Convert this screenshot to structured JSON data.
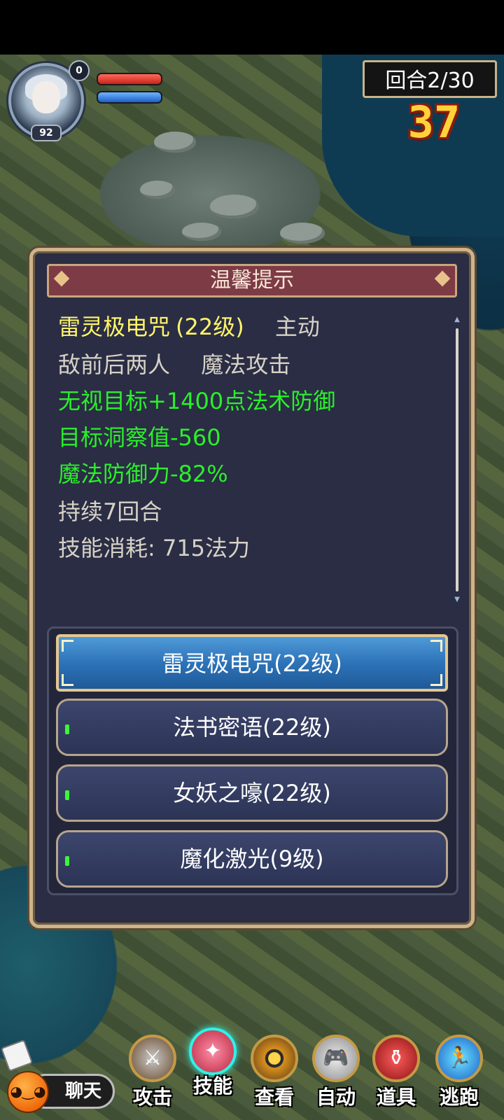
{
  "hud": {
    "player_level": "92",
    "badge_count": "0",
    "round_label": "回合2/30",
    "countdown": "37"
  },
  "dialog": {
    "title": "温馨提示",
    "skill_name": "雷灵极电咒",
    "skill_level": "(22级)",
    "skill_type": "主动",
    "targets": "敌前后两人",
    "attack_type": "魔法攻击",
    "effects": [
      "无视目标+1400点法术防御",
      "目标洞察值-560",
      "魔法防御力-82%"
    ],
    "duration": "持续7回合",
    "cost": "技能消耗: 715法力"
  },
  "skills": [
    {
      "label": "雷灵极电咒(22级)",
      "selected": true
    },
    {
      "label": "法书密语(22级)",
      "selected": false
    },
    {
      "label": "女妖之嚎(22级)",
      "selected": false
    },
    {
      "label": "魔化激光(9级)",
      "selected": false
    }
  ],
  "bottom": {
    "chat_label": "聊天",
    "actions": [
      {
        "label": "攻击",
        "icon": "sword-icon"
      },
      {
        "label": "技能",
        "icon": "skill-scroll-icon"
      },
      {
        "label": "查看",
        "icon": "eye-icon"
      },
      {
        "label": "自动",
        "icon": "gamepad-icon"
      },
      {
        "label": "道具",
        "icon": "potion-icon"
      },
      {
        "label": "逃跑",
        "icon": "run-icon"
      }
    ]
  },
  "colors": {
    "skill_name": "#fff56a",
    "effect_green": "#2bef2b",
    "info_gray": "#d7d2c6",
    "header_bg": "#7d3b46",
    "dialog_bg": "#2a2d44",
    "selected_button": "#2d73b8",
    "countdown": "#ffd23a"
  }
}
